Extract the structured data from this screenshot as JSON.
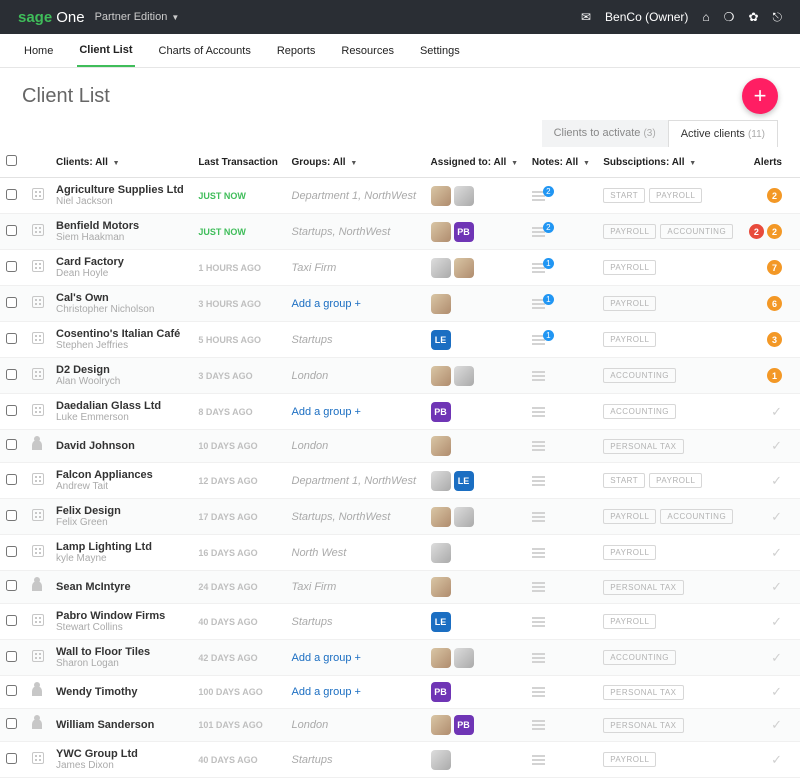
{
  "brand": {
    "sage": "sage",
    "one": "One",
    "partner": "Partner Edition"
  },
  "user": "BenCo (Owner)",
  "nav": [
    "Home",
    "Client List",
    "Charts of Accounts",
    "Reports",
    "Resources",
    "Settings"
  ],
  "navActive": 1,
  "pageTitle": "Client List",
  "viewtabs": {
    "activate": {
      "label": "Clients to activate",
      "count": "(3)"
    },
    "active": {
      "label": "Active clients",
      "count": "(11)"
    }
  },
  "columns": {
    "clients": "Clients: All",
    "last": "Last Transaction",
    "groups": "Groups: All",
    "assigned": "Assigned to: All",
    "notes": "Notes: All",
    "subs": "Subsciptions: All",
    "alerts": "Alerts"
  },
  "addGroup": "Add a group +",
  "rows": [
    {
      "name": "Agriculture Supplies Ltd",
      "contact": "Niel Jackson",
      "type": "company",
      "tx": "JUST NOW",
      "txNow": true,
      "group": "Department 1, NorthWest",
      "assignees": [
        {
          "t": "photo"
        },
        {
          "t": "photo2"
        }
      ],
      "noteCount": 2,
      "subs": [
        "START",
        "PAYROLL"
      ],
      "alerts": [
        {
          "c": "orange",
          "n": 2
        }
      ]
    },
    {
      "name": "Benfield Motors",
      "contact": "Siem Haakman",
      "type": "company",
      "tx": "JUST NOW",
      "txNow": true,
      "group": "Startups, NorthWest",
      "assignees": [
        {
          "t": "photo"
        },
        {
          "t": "pb",
          "txt": "PB"
        }
      ],
      "noteCount": 2,
      "subs": [
        "PAYROLL",
        "ACCOUNTING"
      ],
      "alerts": [
        {
          "c": "red",
          "n": 2
        },
        {
          "c": "orange",
          "n": 2
        }
      ]
    },
    {
      "name": "Card Factory",
      "contact": "Dean Hoyle",
      "type": "company",
      "tx": "1 HOURS AGO",
      "group": "Taxi Firm",
      "assignees": [
        {
          "t": "photo2"
        },
        {
          "t": "photo"
        }
      ],
      "noteCount": 1,
      "subs": [
        "PAYROLL"
      ],
      "alerts": [
        {
          "c": "orange",
          "n": 7
        }
      ]
    },
    {
      "name": "Cal's Own",
      "contact": "Christopher Nicholson",
      "type": "company",
      "tx": "3 HOURS AGO",
      "groupAdd": true,
      "assignees": [
        {
          "t": "photo"
        }
      ],
      "noteCount": 1,
      "subs": [
        "PAYROLL"
      ],
      "alerts": [
        {
          "c": "orange",
          "n": 6
        }
      ]
    },
    {
      "name": "Cosentino's Italian Café",
      "contact": "Stephen Jeffries",
      "type": "company",
      "tx": "5 HOURS AGO",
      "group": "Startups",
      "assignees": [
        {
          "t": "le",
          "txt": "LE"
        }
      ],
      "noteCount": 1,
      "subs": [
        "PAYROLL"
      ],
      "alerts": [
        {
          "c": "orange",
          "n": 3
        }
      ]
    },
    {
      "name": "D2 Design",
      "contact": "Alan Woolrych",
      "type": "company",
      "tx": "3 DAYS AGO",
      "group": "London",
      "assignees": [
        {
          "t": "photo"
        },
        {
          "t": "photo2"
        }
      ],
      "noteCount": 0,
      "subs": [
        "ACCOUNTING"
      ],
      "alerts": [
        {
          "c": "orange",
          "n": 1
        }
      ]
    },
    {
      "name": "Daedalian Glass Ltd",
      "contact": "Luke Emmerson",
      "type": "company",
      "tx": "8 DAYS AGO",
      "groupAdd": true,
      "assignees": [
        {
          "t": "pb",
          "txt": "PB"
        }
      ],
      "noteCount": 0,
      "subs": [
        "ACCOUNTING"
      ],
      "tick": true
    },
    {
      "name": "David Johnson",
      "contact": "",
      "type": "person",
      "tx": "10 DAYS AGO",
      "group": "London",
      "assignees": [
        {
          "t": "photo"
        }
      ],
      "noteCount": 0,
      "subs": [
        "PERSONAL TAX"
      ],
      "tick": true
    },
    {
      "name": "Falcon Appliances",
      "contact": "Andrew Tait",
      "type": "company",
      "tx": "12 DAYS AGO",
      "group": "Department 1, NorthWest",
      "assignees": [
        {
          "t": "photo2"
        },
        {
          "t": "le",
          "txt": "LE"
        }
      ],
      "noteCount": 0,
      "subs": [
        "START",
        "PAYROLL"
      ],
      "tick": true
    },
    {
      "name": "Felix Design",
      "contact": "Felix Green",
      "type": "company",
      "tx": "17 DAYS AGO",
      "group": "Startups, NorthWest",
      "assignees": [
        {
          "t": "photo"
        },
        {
          "t": "photo2"
        }
      ],
      "noteCount": 0,
      "subs": [
        "PAYROLL",
        "ACCOUNTING"
      ],
      "tick": true
    },
    {
      "name": "Lamp Lighting Ltd",
      "contact": "kyle Mayne",
      "type": "company",
      "tx": "16 DAYS AGO",
      "group": "North West",
      "assignees": [
        {
          "t": "photo2"
        }
      ],
      "noteCount": 0,
      "subs": [
        "PAYROLL"
      ],
      "tick": true
    },
    {
      "name": "Sean McIntyre",
      "contact": "",
      "type": "person",
      "tx": "24 DAYS AGO",
      "group": "Taxi Firm",
      "assignees": [
        {
          "t": "photo"
        }
      ],
      "noteCount": 0,
      "subs": [
        "PERSONAL TAX"
      ],
      "tick": true
    },
    {
      "name": "Pabro Window Firms",
      "contact": "Stewart Collins",
      "type": "company",
      "tx": "40 DAYS AGO",
      "group": "Startups",
      "assignees": [
        {
          "t": "le",
          "txt": "LE"
        }
      ],
      "noteCount": 0,
      "subs": [
        "PAYROLL"
      ],
      "tick": true
    },
    {
      "name": "Wall to Floor Tiles",
      "contact": "Sharon Logan",
      "type": "company",
      "tx": "42 DAYS AGO",
      "groupAdd": true,
      "assignees": [
        {
          "t": "photo"
        },
        {
          "t": "photo2"
        }
      ],
      "noteCount": 0,
      "subs": [
        "ACCOUNTING"
      ],
      "tick": true
    },
    {
      "name": "Wendy Timothy",
      "contact": "",
      "type": "person",
      "tx": "100 DAYS AGO",
      "groupAdd": true,
      "assignees": [
        {
          "t": "pb",
          "txt": "PB"
        }
      ],
      "noteCount": 0,
      "subs": [
        "PERSONAL TAX"
      ],
      "tick": true
    },
    {
      "name": "William Sanderson",
      "contact": "",
      "type": "person",
      "tx": "101 DAYS AGO",
      "group": "London",
      "assignees": [
        {
          "t": "photo"
        },
        {
          "t": "pb",
          "txt": "PB"
        }
      ],
      "noteCount": 0,
      "subs": [
        "PERSONAL TAX"
      ],
      "tick": true
    },
    {
      "name": "YWC Group Ltd",
      "contact": "James Dixon",
      "type": "company",
      "tx": "40 DAYS AGO",
      "group": "Startups",
      "assignees": [
        {
          "t": "photo2"
        }
      ],
      "noteCount": 0,
      "subs": [
        "PAYROLL"
      ],
      "tick": true
    }
  ]
}
